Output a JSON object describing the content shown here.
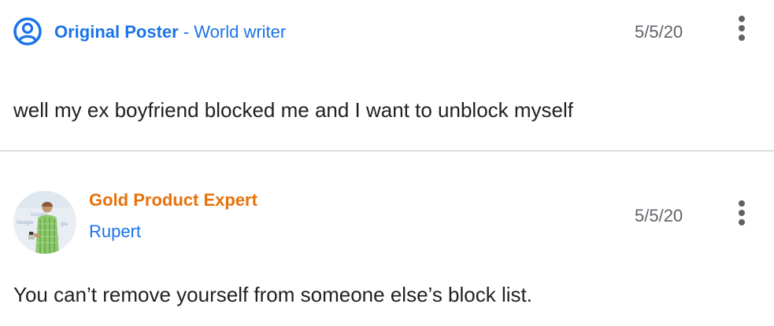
{
  "original_post": {
    "avatar_icon": "account-circle-icon",
    "author_label": "Original Poster",
    "separator": " - ",
    "author_name": "World writer",
    "date": "5/5/20",
    "menu_icon": "more-vert-icon",
    "body": "well my ex boyfriend blocked me and I want to unblock myself"
  },
  "reply": {
    "avatar": "user-photo-avatar",
    "expert_level": "Gold Product Expert",
    "author_name": "Rupert",
    "date": "5/5/20",
    "menu_icon": "more-vert-icon",
    "body": "You can’t remove yourself from someone else’s block list."
  },
  "colors": {
    "link_blue": "#1a73e8",
    "gold_expert": "#e8710a",
    "text": "#202124",
    "secondary": "#5f6368",
    "divider": "#dadce0"
  }
}
